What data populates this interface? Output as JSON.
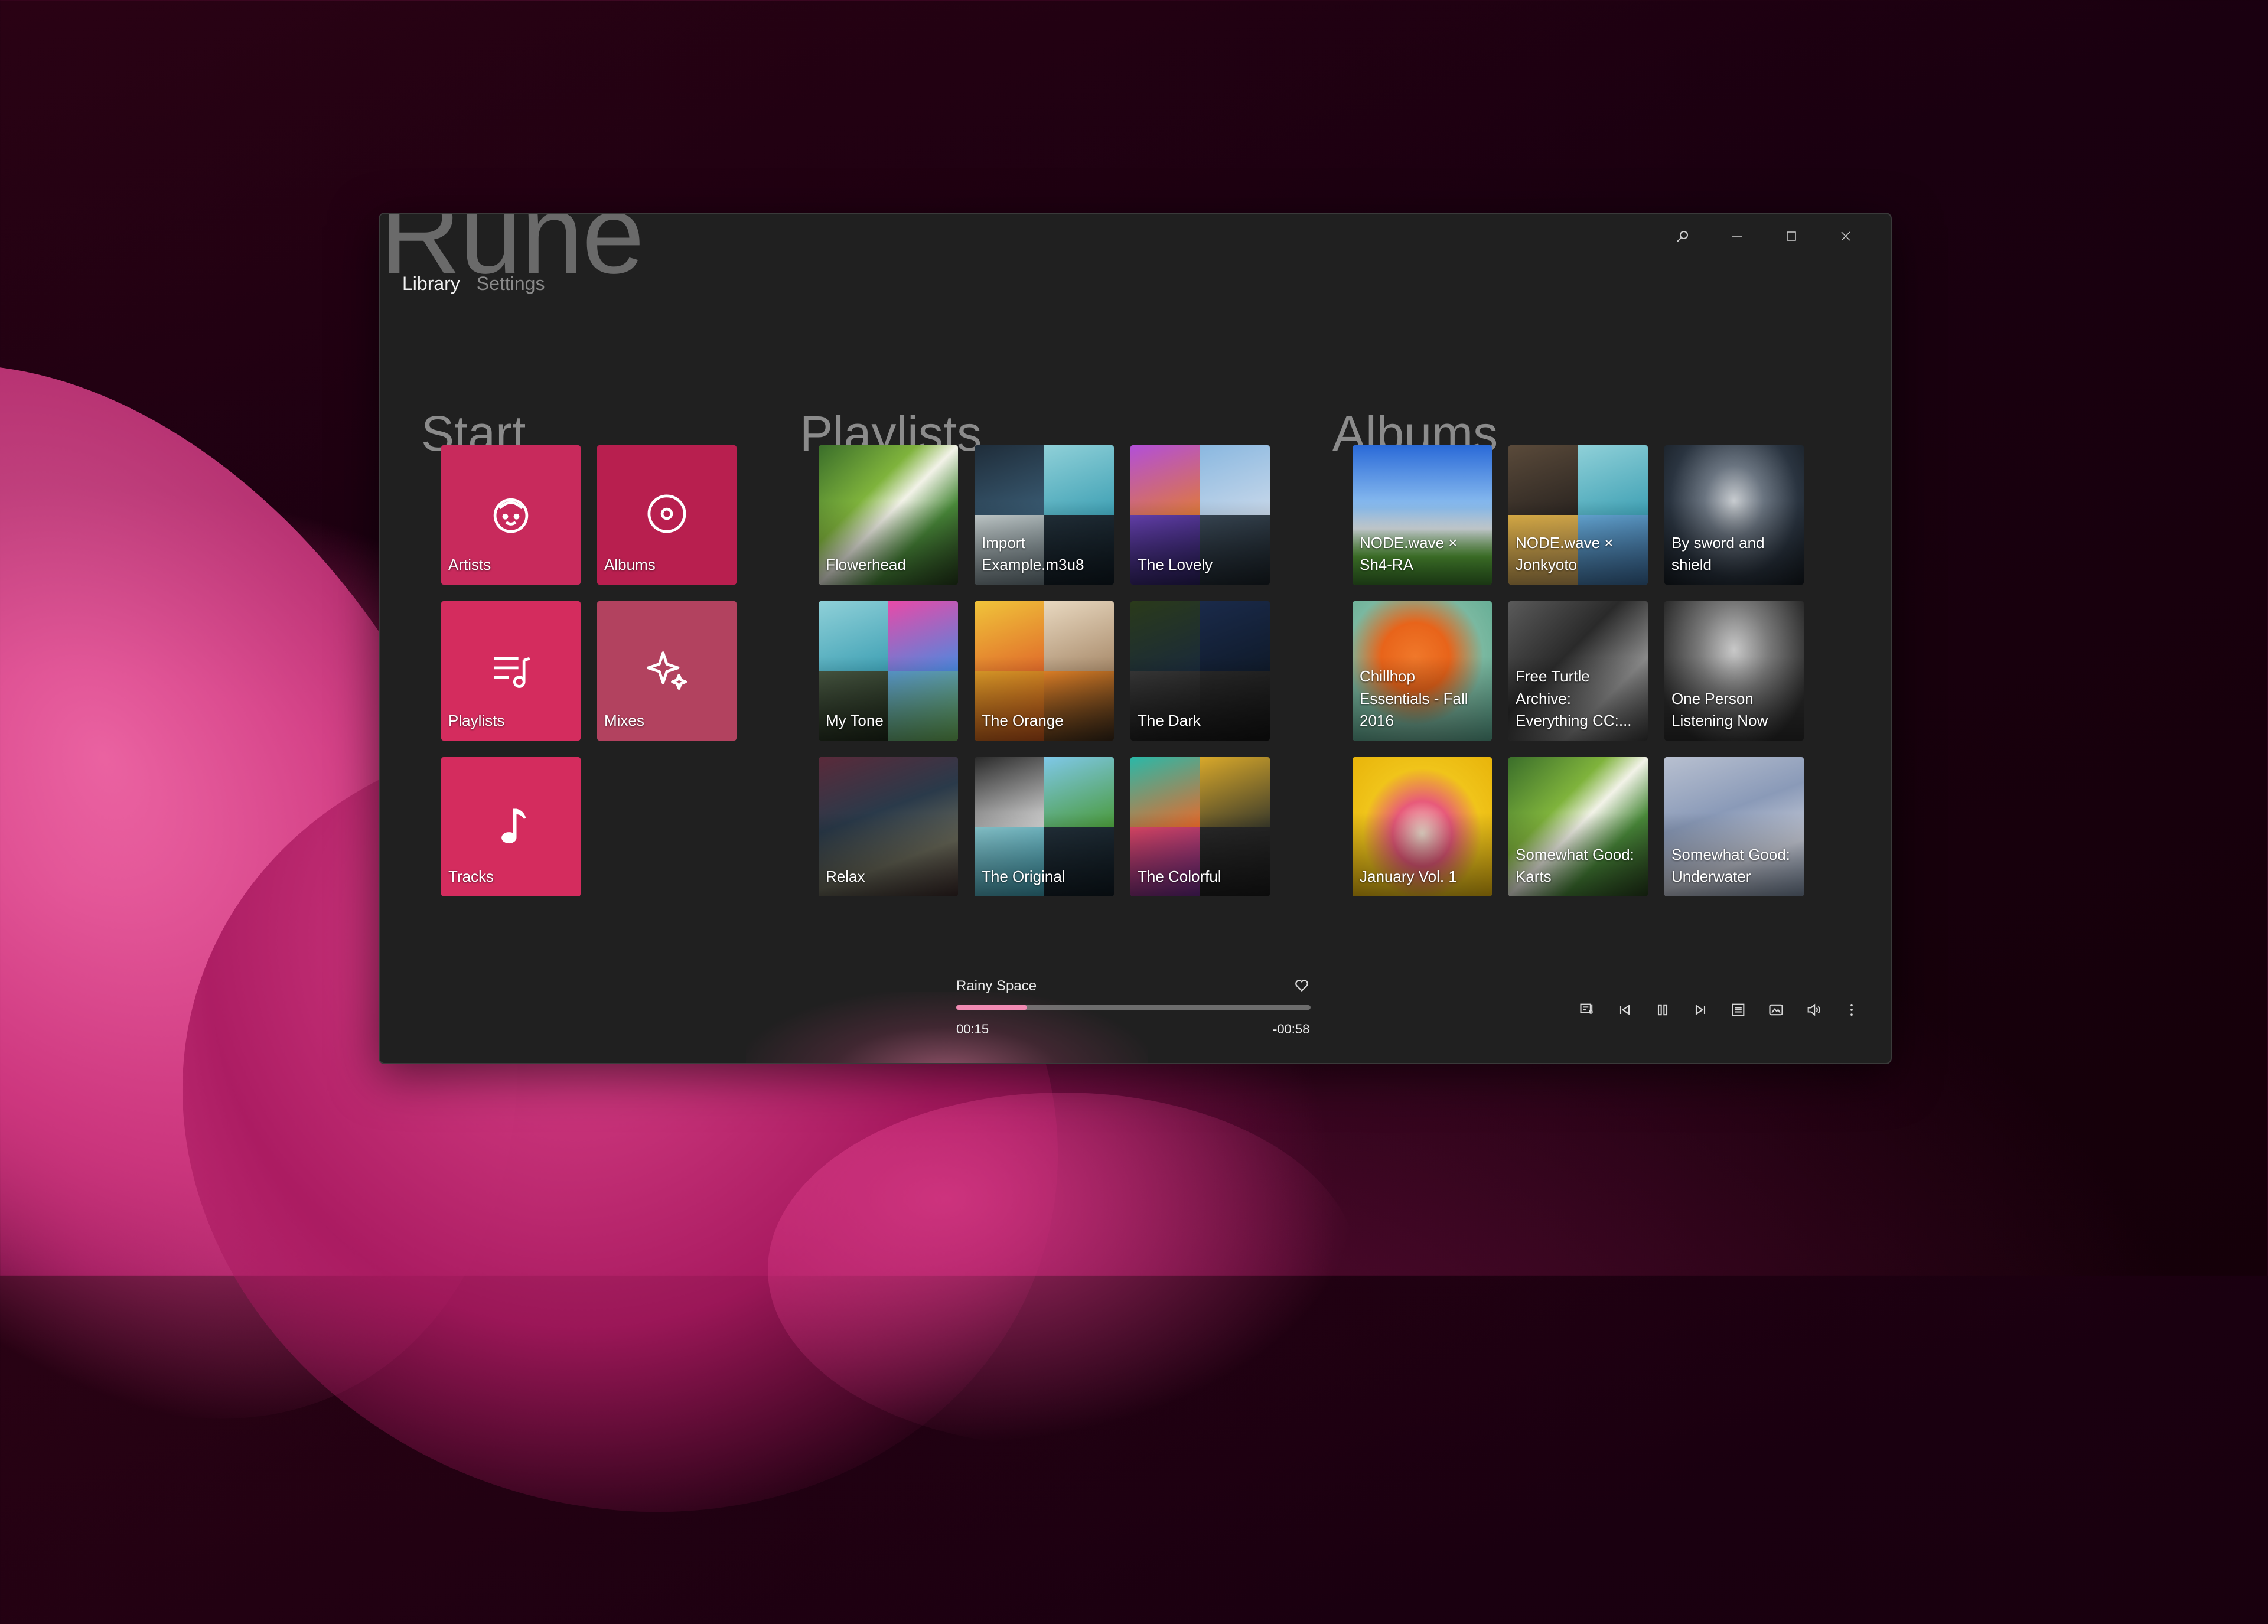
{
  "window": {
    "app_title": "Rune",
    "tabs": [
      "Library",
      "Settings"
    ],
    "controls": [
      "search-icon",
      "minimize-icon",
      "maximize-icon",
      "close-icon"
    ]
  },
  "sections": {
    "start": "Start",
    "playlists": "Playlists",
    "albums": "Albums"
  },
  "start_tiles": [
    {
      "label": "Artists",
      "icon": "face-icon",
      "color": "#c82a5c"
    },
    {
      "label": "Albums",
      "icon": "disc-icon",
      "color": "#b81f4f"
    },
    {
      "label": "Playlists",
      "icon": "playlist-icon",
      "color": "#d42c5e"
    },
    {
      "label": "Mixes",
      "icon": "sparkle-icon",
      "color": "#b2425f"
    },
    {
      "label": "Tracks",
      "icon": "music-note-icon",
      "color": "#d42c5e"
    }
  ],
  "playlists": [
    {
      "label": "Flowerhead"
    },
    {
      "label": "Import Example.m3u8"
    },
    {
      "label": "The Lovely"
    },
    {
      "label": "My Tone"
    },
    {
      "label": "The Orange"
    },
    {
      "label": "The Dark"
    },
    {
      "label": "Relax"
    },
    {
      "label": "The Original"
    },
    {
      "label": "The Colorful"
    }
  ],
  "albums": [
    {
      "label": "NODE.wave × Sh4-RA"
    },
    {
      "label": "NODE.wave × Jonkyoto"
    },
    {
      "label": "By sword and shield"
    },
    {
      "label": "Chillhop Essentials - Fall 2016"
    },
    {
      "label": "Free Turtle Archive: Everything CC:..."
    },
    {
      "label": "One Person Listening Now"
    },
    {
      "label": "January Vol. 1"
    },
    {
      "label": "Somewhat Good: Karts"
    },
    {
      "label": "Somewhat Good: Underwater"
    }
  ],
  "player": {
    "track": "Rainy Space",
    "elapsed": "00:15",
    "remaining": "-00:58",
    "progress": 0.2,
    "accent": "#f28ab3",
    "controls": [
      "lyrics-icon",
      "previous-icon",
      "pause-icon",
      "next-icon",
      "queue-icon",
      "cover-art-icon",
      "volume-icon",
      "more-icon"
    ]
  }
}
